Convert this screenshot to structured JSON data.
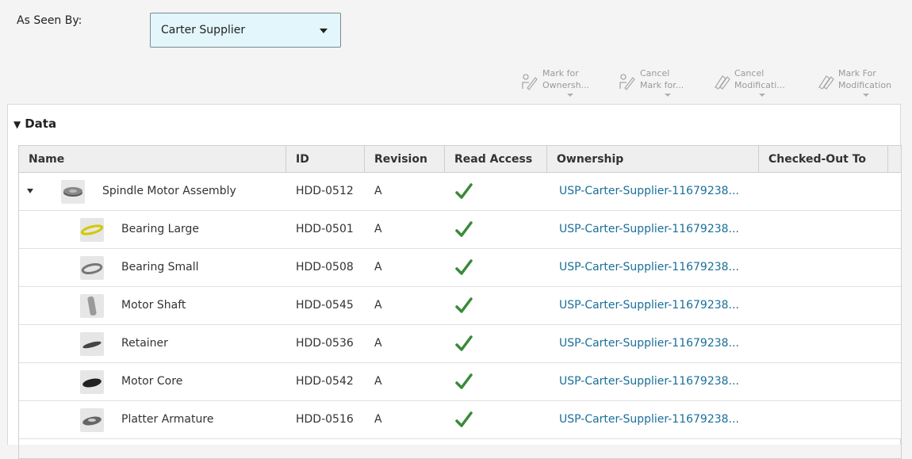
{
  "as_seen_by": {
    "label": "As Seen By:",
    "selected": "Carter Supplier"
  },
  "toolbar": [
    {
      "line1": "Mark for",
      "line2": "Ownersh...",
      "icon": "mark-ownership-icon"
    },
    {
      "line1": "Cancel",
      "line2": "Mark for...",
      "icon": "cancel-mark-ownership-icon"
    },
    {
      "line1": "Cancel",
      "line2": "Modificati...",
      "icon": "cancel-modification-icon"
    },
    {
      "line1": "Mark For",
      "line2": "Modification",
      "icon": "mark-modification-icon"
    }
  ],
  "panel": {
    "arrow": "▼",
    "title": "Data"
  },
  "table": {
    "columns": [
      "Name",
      "ID",
      "Revision",
      "Read Access",
      "Ownership",
      "Checked-Out To"
    ],
    "rows": [
      {
        "name": "Spindle Motor Assembly",
        "id": "HDD-0512",
        "revision": "A",
        "read_access": "check-icon",
        "ownership": "USP-Carter-Supplier-11679238...",
        "checked_out": "",
        "thumb": "assembly-thumbnail"
      },
      {
        "name": "Bearing Large",
        "id": "HDD-0501",
        "revision": "A",
        "read_access": "check-icon",
        "ownership": "USP-Carter-Supplier-11679238...",
        "checked_out": "",
        "thumb": "bearing-large-thumbnail"
      },
      {
        "name": "Bearing Small",
        "id": "HDD-0508",
        "revision": "A",
        "read_access": "check-icon",
        "ownership": "USP-Carter-Supplier-11679238...",
        "checked_out": "",
        "thumb": "bearing-small-thumbnail"
      },
      {
        "name": "Motor Shaft",
        "id": "HDD-0545",
        "revision": "A",
        "read_access": "check-icon",
        "ownership": "USP-Carter-Supplier-11679238...",
        "checked_out": "",
        "thumb": "motor-shaft-thumbnail"
      },
      {
        "name": "Retainer",
        "id": "HDD-0536",
        "revision": "A",
        "read_access": "check-icon",
        "ownership": "USP-Carter-Supplier-11679238...",
        "checked_out": "",
        "thumb": "retainer-thumbnail"
      },
      {
        "name": "Motor Core",
        "id": "HDD-0542",
        "revision": "A",
        "read_access": "check-icon",
        "ownership": "USP-Carter-Supplier-11679238...",
        "checked_out": "",
        "thumb": "motor-core-thumbnail"
      },
      {
        "name": "Platter Armature",
        "id": "HDD-0516",
        "revision": "A",
        "read_access": "check-icon",
        "ownership": "USP-Carter-Supplier-11679238...",
        "checked_out": "",
        "thumb": "platter-armature-thumbnail"
      }
    ]
  },
  "colors": {
    "link": "#1a6f99",
    "check": "#3a8a3a",
    "dropdown_bg": "#e3f6fb"
  }
}
